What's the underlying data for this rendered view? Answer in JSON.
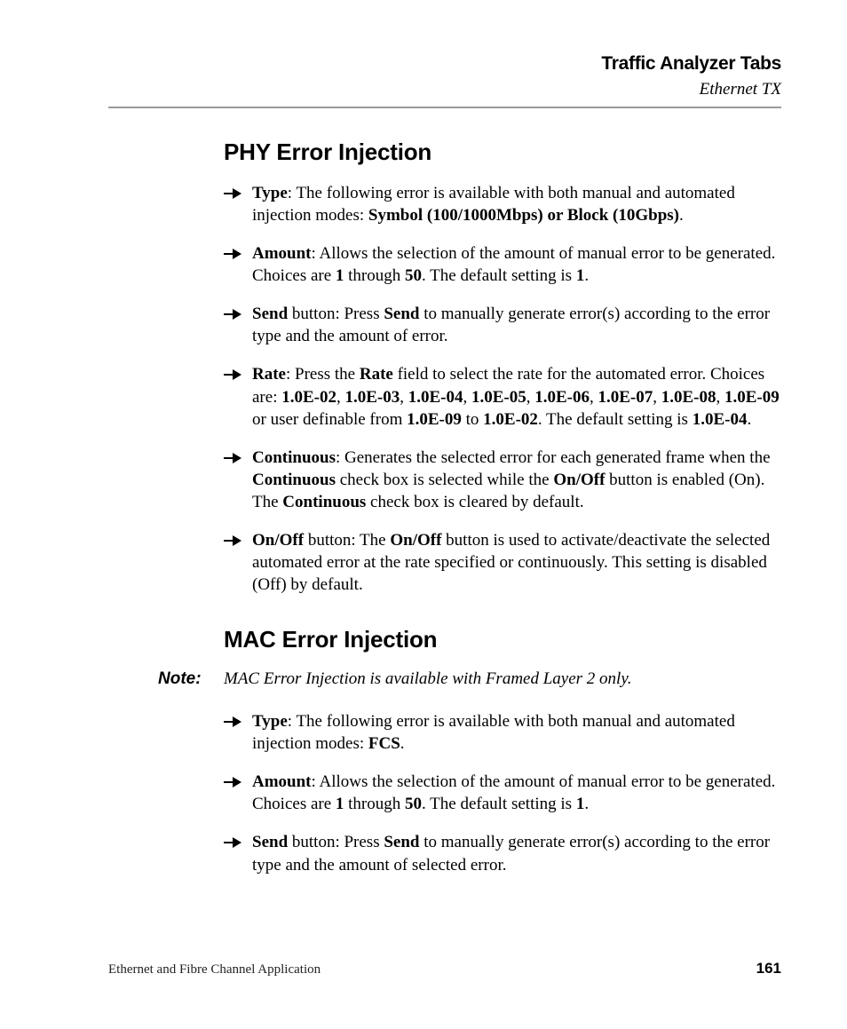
{
  "header": {
    "title": "Traffic Analyzer Tabs",
    "subtitle": "Ethernet TX"
  },
  "sections": {
    "phy": {
      "heading": "PHY Error Injection",
      "items": {
        "type": {
          "label": "Type",
          "t1": ": The following error is available with both manual and automated injection modes: ",
          "mode": "Symbol (100/1000Mbps) or Block (10Gbps)",
          "t2": "."
        },
        "amount": {
          "label": "Amount",
          "t1": ": Allows the selection of the amount of manual error to be generated. Choices are ",
          "min": "1",
          "t2": " through ",
          "max": "50",
          "t3": ". The default setting is ",
          "def": "1",
          "t4": "."
        },
        "send": {
          "label": "Send",
          "t1": " button: Press ",
          "btn": "Send",
          "t2": " to manually generate error(s) according to the error type and the amount of error."
        },
        "rate": {
          "label": "Rate",
          "t1": ": Press the ",
          "field": "Rate",
          "t2": " field to select the rate for the automated error. Choices are: ",
          "r1": "1.0E-02",
          "c1": ", ",
          "r2": "1.0E-03",
          "c2": ", ",
          "r3": "1.0E-04",
          "c3": ", ",
          "r4": "1.0E-05",
          "c4": ", ",
          "r5": "1.0E-06",
          "c5": ", ",
          "r6": "1.0E-07",
          "c6": ", ",
          "r7": "1.0E-08",
          "c7": ", ",
          "r8": "1.0E-09",
          "t3": " or user definable from ",
          "rfrom": "1.0E-09",
          "t4": " to ",
          "rto": "1.0E-02",
          "t5": ". The default setting is ",
          "rdef": "1.0E-04",
          "t6": "."
        },
        "continuous": {
          "label": "Continuous",
          "t1": ": Generates the selected error for each generated frame when the ",
          "w1": "Continuous",
          "t2": " check box is selected while the ",
          "w2": "On/Off",
          "t3": " button is enabled (On). The ",
          "w3": "Continuous",
          "t4": " check box is cleared by default."
        },
        "onoff": {
          "label": "On/Off",
          "t1": " button: The ",
          "w1": "On/Off",
          "t2": " button is used to activate/deactivate the selected automated error at the rate specified or continuously. This setting is disabled (Off) by default."
        }
      }
    },
    "mac": {
      "heading": "MAC Error Injection",
      "note": {
        "label": "Note:",
        "text": "MAC Error Injection is available with Framed Layer 2 only."
      },
      "items": {
        "type": {
          "label": "Type",
          "t1": ": The following error is available with both manual and automated injection modes: ",
          "mode": "FCS",
          "t2": "."
        },
        "amount": {
          "label": "Amount",
          "t1": ": Allows the selection of the amount of manual error to be generated. Choices are ",
          "min": "1",
          "t2": " through ",
          "max": "50",
          "t3": ". The default setting is ",
          "def": "1",
          "t4": "."
        },
        "send": {
          "label": "Send",
          "t1": " button: Press ",
          "btn": "Send",
          "t2": " to manually generate error(s) according to the error type and the amount of selected error."
        }
      }
    }
  },
  "footer": {
    "left": "Ethernet and Fibre Channel Application",
    "page": "161"
  }
}
